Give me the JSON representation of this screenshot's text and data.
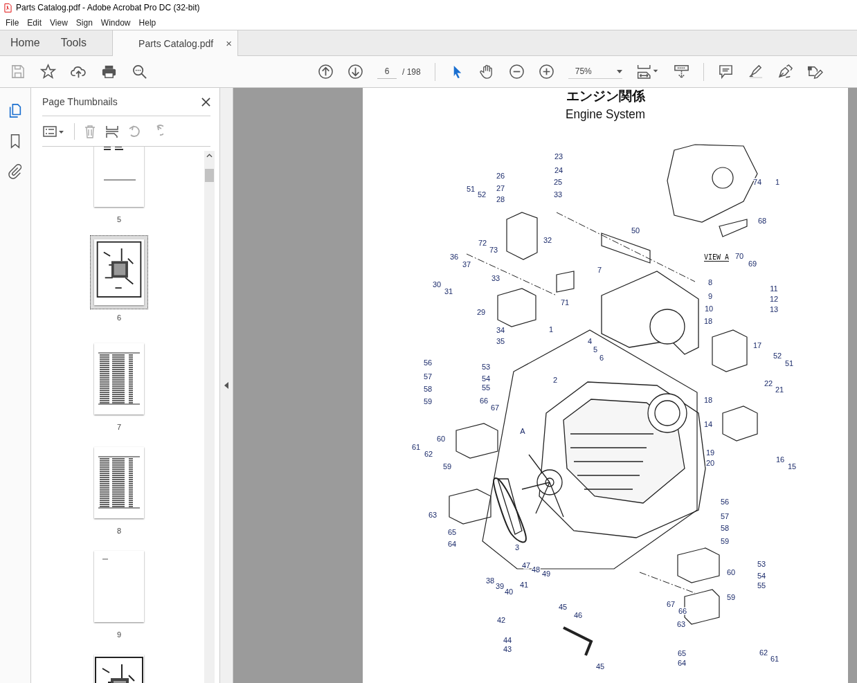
{
  "window": {
    "title": "Parts Catalog.pdf - Adobe Acrobat Pro DC (32-bit)"
  },
  "menu": [
    "File",
    "Edit",
    "View",
    "Sign",
    "Window",
    "Help"
  ],
  "tabs": [
    {
      "label": "Home",
      "selected": false
    },
    {
      "label": "Tools",
      "selected": false
    },
    {
      "label": "Parts Catalog.pdf",
      "selected": true,
      "close": "×"
    }
  ],
  "toolbar": {
    "page": "6",
    "page_total": "/ 198",
    "zoom": "75%"
  },
  "sidebar": {
    "title": "Page Thumbnails",
    "thumbnails": [
      {
        "label": "5",
        "kind": "text",
        "selected": false
      },
      {
        "label": "6",
        "kind": "drawing",
        "selected": true
      },
      {
        "label": "7",
        "kind": "table",
        "selected": false
      },
      {
        "label": "8",
        "kind": "table",
        "selected": false
      },
      {
        "label": "9",
        "kind": "blank",
        "selected": false
      },
      {
        "kind": "drawing",
        "selected": false
      }
    ]
  },
  "document": {
    "title_ja": "エンジン関係",
    "title_en": "Engine System",
    "view_label": "VIEW A",
    "callouts": [
      "23",
      "24",
      "25",
      "33",
      "26",
      "27",
      "28",
      "51",
      "52",
      "32",
      "72",
      "73",
      "36",
      "37",
      "30",
      "31",
      "33",
      "71",
      "29",
      "34",
      "35",
      "1",
      "4",
      "5",
      "6",
      "2",
      "7",
      "50",
      "74",
      "1",
      "68",
      "70",
      "69",
      "8",
      "9",
      "10",
      "18",
      "11",
      "12",
      "13",
      "17",
      "52",
      "51",
      "22",
      "21",
      "18",
      "14",
      "19",
      "20",
      "16",
      "15",
      "56",
      "57",
      "58",
      "59",
      "53",
      "54",
      "55",
      "66",
      "67",
      "60",
      "61",
      "62",
      "59",
      "63",
      "65",
      "64",
      "A",
      "3",
      "47",
      "48",
      "49",
      "38",
      "39",
      "40",
      "41",
      "42",
      "44",
      "43",
      "45",
      "46",
      "45",
      "56",
      "57",
      "58",
      "59",
      "60",
      "53",
      "54",
      "55",
      "59",
      "67",
      "66",
      "63",
      "65",
      "64",
      "62",
      "61"
    ]
  }
}
